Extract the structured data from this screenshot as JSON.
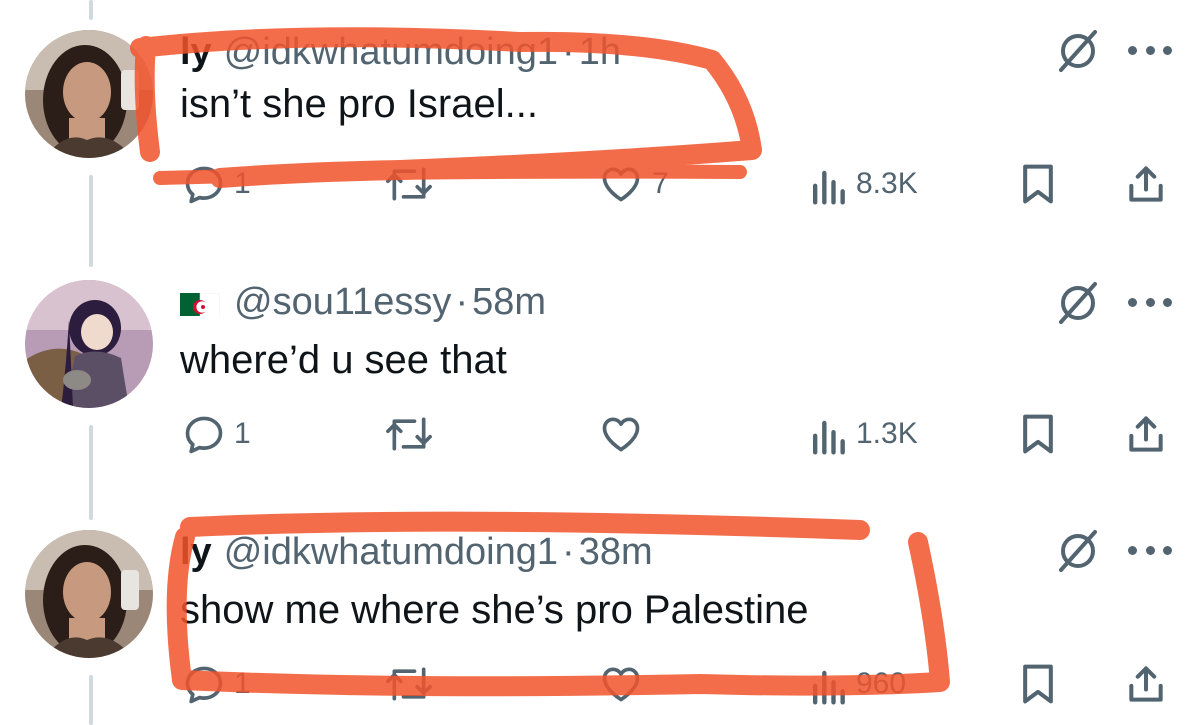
{
  "tweets": [
    {
      "name": "ly",
      "handle": "@idkwhatumdoing1",
      "separator": "·",
      "time": "1h",
      "text": "isn’t she pro Israel...",
      "replies": "1",
      "retweets": "",
      "likes": "7",
      "views": "8.3K"
    },
    {
      "name": "",
      "flag": "algeria-flag",
      "handle": "@sou11essy",
      "separator": "·",
      "time": "58m",
      "text": "where’d u see that",
      "replies": "1",
      "retweets": "",
      "likes": "",
      "views": "1.3K"
    },
    {
      "name": "ly",
      "handle": "@idkwhatumdoing1",
      "separator": "·",
      "time": "38m",
      "text": "show me where she’s pro Palestine",
      "replies": "1",
      "retweets": "",
      "likes": "",
      "views": "960"
    }
  ],
  "icons": [
    "reply-icon",
    "retweet-icon",
    "like-icon",
    "views-icon",
    "bookmark-icon",
    "share-icon",
    "grok-icon",
    "more-icon"
  ],
  "colors": {
    "text_primary": "#0f1419",
    "text_secondary": "#536471",
    "thread_line": "#cfd9de",
    "scribble": "#f2532b"
  }
}
